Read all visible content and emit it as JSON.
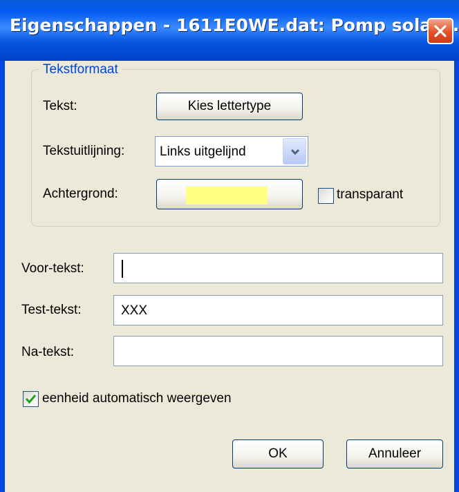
{
  "window": {
    "title": "Eigenschappen - 1611E0WE.dat: Pomp solar ...",
    "close_glyph": "close-icon"
  },
  "group": {
    "legend": "Tekstformaat"
  },
  "text_row": {
    "label": "Tekst:",
    "button_label": "Kies lettertype"
  },
  "align_row": {
    "label": "Tekstuitlijning:",
    "selected": "Links uitgelijnd"
  },
  "background_row": {
    "label": "Achtergrond:",
    "color": "#ffff80",
    "transparent_label": "transparant",
    "transparent_checked": false
  },
  "fields": {
    "voor": {
      "label": "Voor-tekst:",
      "value": ""
    },
    "test": {
      "label": "Test-tekst:",
      "value": "XXX"
    },
    "na": {
      "label": "Na-tekst:",
      "value": ""
    }
  },
  "auto_unit": {
    "label": "eenheid automatisch weergeven",
    "checked": true
  },
  "buttons": {
    "ok": "OK",
    "cancel": "Annuleer"
  },
  "colors": {
    "title_blue": "#0058ee",
    "face": "#ece9d8",
    "group_title": "#0046d5",
    "check_green": "#21a121",
    "close_red": "#e2532a"
  }
}
